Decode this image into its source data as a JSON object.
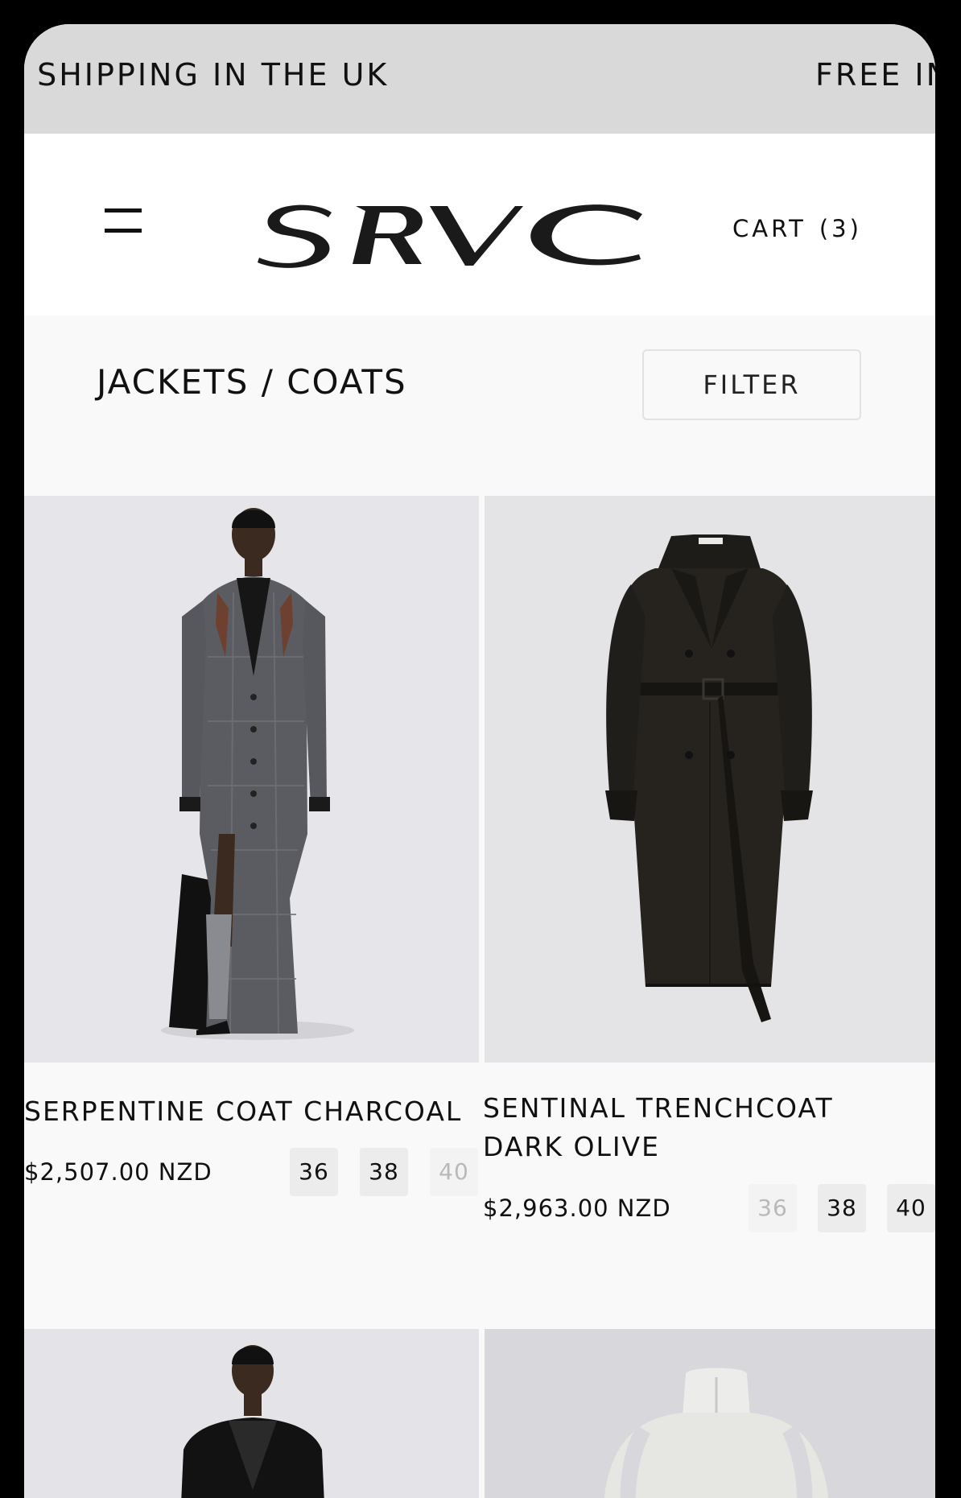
{
  "announcement": {
    "marquee_left": "E SHIPPING IN THE UK",
    "marquee_right": "FREE IN"
  },
  "header": {
    "logo_text": "SRVC",
    "cart_label": "CART",
    "cart_count": "(3)"
  },
  "collection": {
    "title": "JACKETS / COATS",
    "filter_label": "FILTER"
  },
  "products": [
    {
      "name": "SERPENTINE COAT CHARCOAL",
      "price": "$2,507.00 NZD",
      "sizes": [
        {
          "label": "36",
          "available": true
        },
        {
          "label": "38",
          "available": true
        },
        {
          "label": "40",
          "available": false
        }
      ]
    },
    {
      "name": "SENTINAL TRENCHCOAT DARK OLIVE",
      "price": "$2,963.00 NZD",
      "sizes": [
        {
          "label": "36",
          "available": false
        },
        {
          "label": "38",
          "available": true
        },
        {
          "label": "40",
          "available": true
        }
      ]
    }
  ],
  "icons": {
    "menu": "hamburger-menu-icon"
  },
  "colors": {
    "announcement_bg": "#d9d9d9",
    "page_bg": "#f9f9f9",
    "text": "#111111",
    "size_unavailable": "#b9b9b9"
  }
}
